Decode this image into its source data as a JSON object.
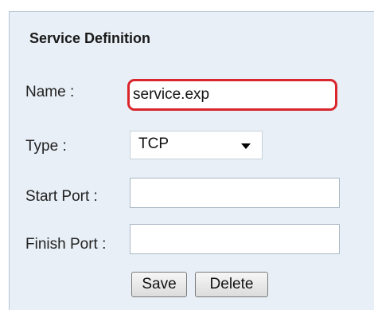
{
  "section_title": "Service Definition",
  "fields": {
    "name": {
      "label": "Name :",
      "value": "service.exp"
    },
    "type": {
      "label": "Type :",
      "value": "TCP"
    },
    "start_port": {
      "label": "Start Port :",
      "value": ""
    },
    "finish_port": {
      "label": "Finish Port :",
      "value": ""
    }
  },
  "buttons": {
    "save": "Save",
    "delete": "Delete"
  },
  "colors": {
    "panel_background": "#e8eff6",
    "highlight_border": "#d9262c"
  },
  "icons": {
    "type_dropdown": "caret-down-icon"
  }
}
